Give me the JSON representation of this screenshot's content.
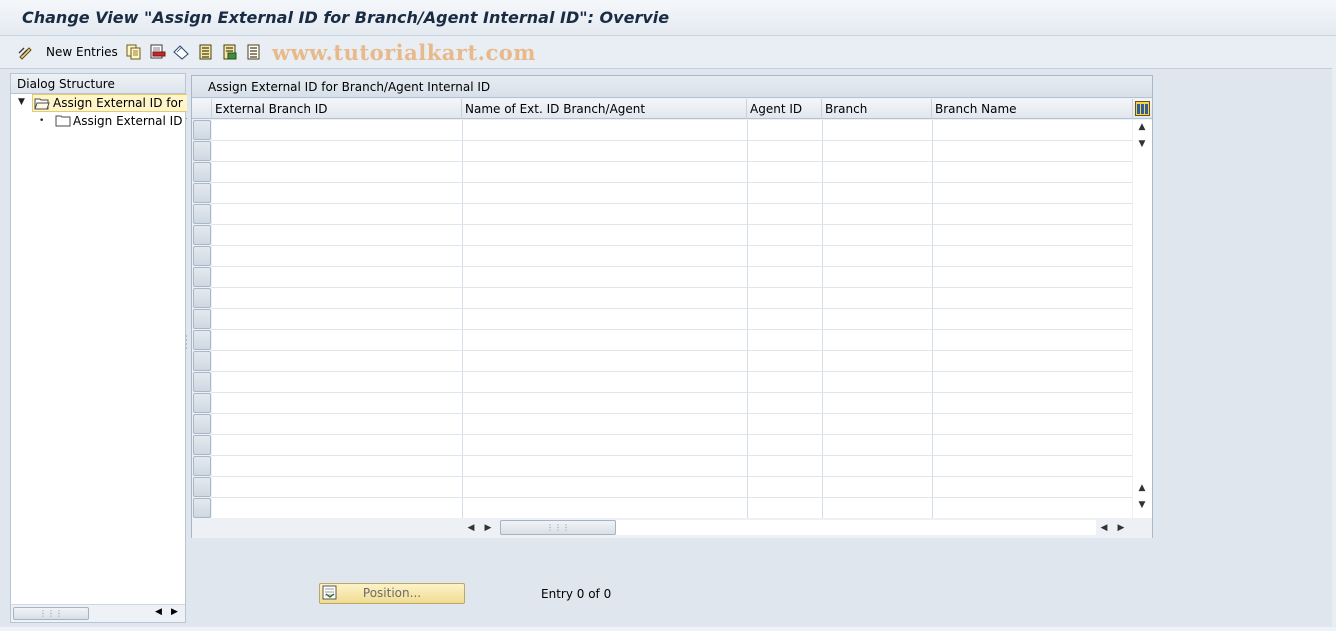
{
  "window": {
    "title": "Change View \"Assign External ID for Branch/Agent Internal ID\": Overvie"
  },
  "toolbar": {
    "new_entries_label": "New Entries",
    "watermark": "www.tutorialkart.com",
    "icons": [
      "display-change-icon",
      "copy-as-icon",
      "delete-icon",
      "undo-change-icon",
      "select-all-icon",
      "select-block-icon",
      "deselect-all-icon"
    ]
  },
  "dialog_structure": {
    "header": "Dialog Structure",
    "items": [
      {
        "label": "Assign External ID for Br",
        "level": 0,
        "selected": true,
        "expanded": true
      },
      {
        "label": "Assign External ID fo",
        "level": 1,
        "selected": false
      }
    ]
  },
  "table": {
    "title": "Assign External ID for Branch/Agent Internal ID",
    "columns": [
      "External Branch ID",
      "Name of Ext. ID Branch/Agent",
      "Agent ID",
      "Branch",
      "Branch Name"
    ],
    "rows": [],
    "visible_empty_rows": 19
  },
  "footer": {
    "position_button_label": "Position...",
    "entry_status": "Entry 0 of 0"
  },
  "colors": {
    "background": "#dfe6ee",
    "selected_tree_item": "#fff5c8",
    "position_button": "#f0dc92"
  }
}
